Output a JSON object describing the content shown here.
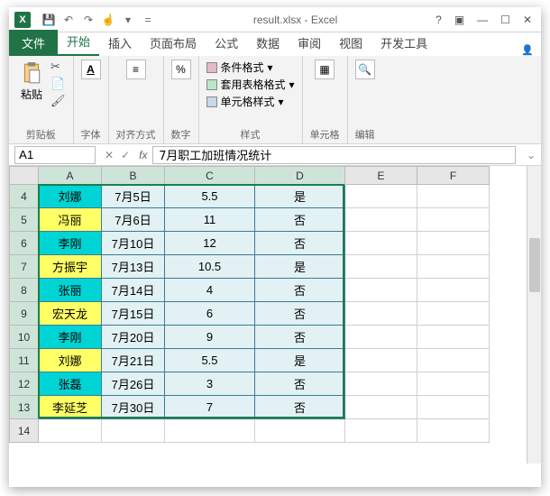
{
  "title": "result.xlsx - Excel",
  "tabs": {
    "file": "文件",
    "list": [
      "开始",
      "插入",
      "页面布局",
      "公式",
      "数据",
      "审阅",
      "视图",
      "开发工具"
    ],
    "active": 0
  },
  "ribbon": {
    "clipboard": {
      "paste": "粘贴",
      "label": "剪贴板"
    },
    "font": {
      "label": "字体"
    },
    "align": {
      "label": "对齐方式"
    },
    "number": {
      "label": "数字"
    },
    "styles": {
      "cond": "条件格式",
      "tbl": "套用表格格式",
      "cell": "单元格样式",
      "label": "样式"
    },
    "cells": {
      "label": "单元格"
    },
    "editing": {
      "label": "编辑"
    }
  },
  "namebox": "A1",
  "formula": "7月职工加班情况统计",
  "cols": [
    "A",
    "B",
    "C",
    "D",
    "E",
    "F"
  ],
  "rows": [
    {
      "n": 4,
      "name": "刘娜",
      "nc": "cyan",
      "date": "7月5日",
      "val": "5.5",
      "flag": "是"
    },
    {
      "n": 5,
      "name": "冯丽",
      "nc": "yel",
      "date": "7月6日",
      "val": "11",
      "flag": "否"
    },
    {
      "n": 6,
      "name": "李刚",
      "nc": "cyan",
      "date": "7月10日",
      "val": "12",
      "flag": "否"
    },
    {
      "n": 7,
      "name": "方振宇",
      "nc": "yel",
      "date": "7月13日",
      "val": "10.5",
      "flag": "是"
    },
    {
      "n": 8,
      "name": "张丽",
      "nc": "cyan",
      "date": "7月14日",
      "val": "4",
      "flag": "否"
    },
    {
      "n": 9,
      "name": "宏天龙",
      "nc": "yel",
      "date": "7月15日",
      "val": "6",
      "flag": "否"
    },
    {
      "n": 10,
      "name": "李刚",
      "nc": "cyan",
      "date": "7月20日",
      "val": "9",
      "flag": "否"
    },
    {
      "n": 11,
      "name": "刘娜",
      "nc": "yel",
      "date": "7月21日",
      "val": "5.5",
      "flag": "是"
    },
    {
      "n": 12,
      "name": "张磊",
      "nc": "cyan",
      "date": "7月26日",
      "val": "3",
      "flag": "否"
    },
    {
      "n": 13,
      "name": "李延芝",
      "nc": "yel",
      "date": "7月30日",
      "val": "7",
      "flag": "否"
    },
    {
      "n": 14
    }
  ]
}
